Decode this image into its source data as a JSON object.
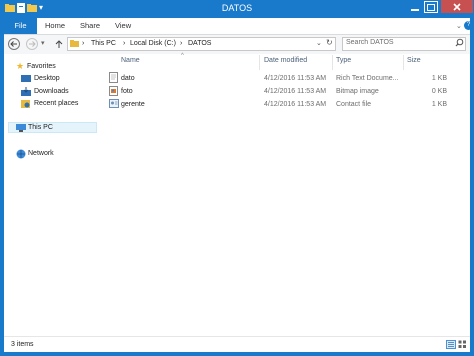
{
  "window": {
    "title": "DATOS"
  },
  "ribbon": {
    "tabs": [
      "File",
      "Home",
      "Share",
      "View"
    ]
  },
  "nav": {
    "path": [
      "This PC",
      "Local Disk (C:)",
      "DATOS"
    ],
    "search_placeholder": "Search DATOS"
  },
  "sidebar": {
    "favorites_label": "Favorites",
    "favorites": [
      "Desktop",
      "Downloads",
      "Recent places"
    ],
    "this_pc": "This PC",
    "network": "Network"
  },
  "columns": {
    "name": "Name",
    "date": "Date modified",
    "type": "Type",
    "size": "Size"
  },
  "files": [
    {
      "name": "dato",
      "date": "4/12/2016 11:53 AM",
      "type": "Rich Text Docume...",
      "size": "1 KB",
      "icon": "rtf-document-icon"
    },
    {
      "name": "foto",
      "date": "4/12/2016 11:53 AM",
      "type": "Bitmap image",
      "size": "0 KB",
      "icon": "bitmap-image-icon"
    },
    {
      "name": "gerente",
      "date": "4/12/2016 11:53 AM",
      "type": "Contact file",
      "size": "1 KB",
      "icon": "contact-file-icon"
    }
  ],
  "status": {
    "item_count": "3 items"
  },
  "colors": {
    "accent": "#1979ca",
    "selected": "#e5f3fb"
  }
}
